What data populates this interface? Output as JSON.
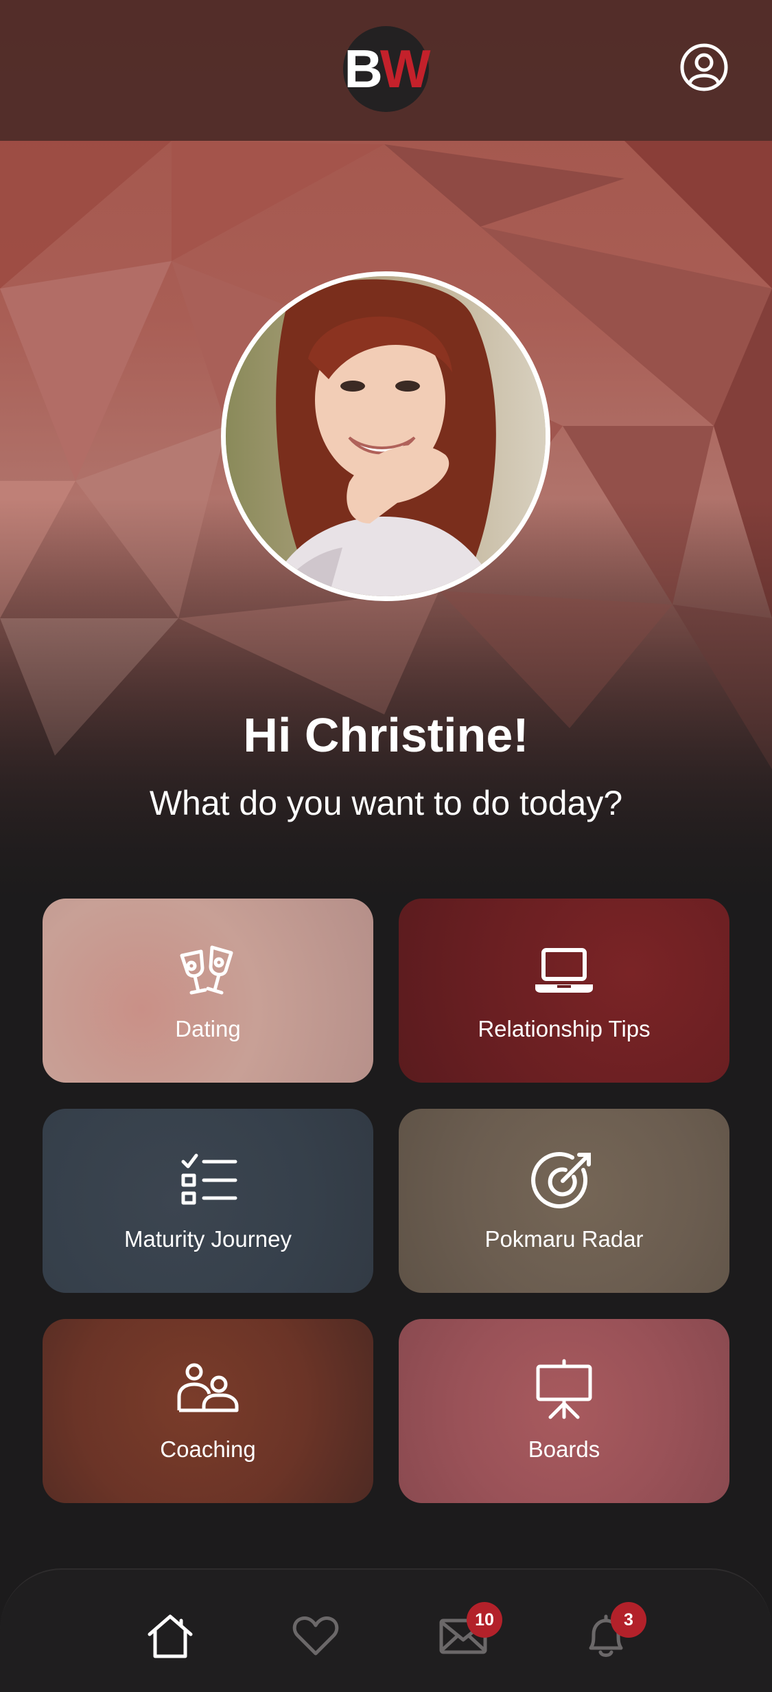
{
  "header": {
    "logo": {
      "letter1": "B",
      "letter2": "W",
      "letter2_color": "#c4212b"
    },
    "profile_icon": "user-circle-icon"
  },
  "hero": {
    "greeting": "Hi Christine!",
    "subtitle": "What do you want to do today?"
  },
  "tiles": [
    {
      "label": "Dating",
      "icon": "wine-glasses-icon",
      "color": "#c8a096"
    },
    {
      "label": "Relationship Tips",
      "icon": "laptop-icon",
      "color": "#6a1f22"
    },
    {
      "label": "Maturity Journey",
      "icon": "checklist-icon",
      "color": "#36404b"
    },
    {
      "label": "Pokmaru Radar",
      "icon": "target-icon",
      "color": "#6b5d50"
    },
    {
      "label": "Coaching",
      "icon": "people-icon",
      "color": "#6b3427"
    },
    {
      "label": "Boards",
      "icon": "presentation-board-icon",
      "color": "#9a5258"
    }
  ],
  "bottom_nav": {
    "items": [
      {
        "name": "home",
        "icon": "home-icon"
      },
      {
        "name": "favorites",
        "icon": "heart-icon"
      },
      {
        "name": "messages",
        "icon": "mail-icon",
        "badge": "10"
      },
      {
        "name": "notifications",
        "icon": "bell-icon",
        "badge": "3"
      }
    ],
    "badge_color": "#b3212a"
  },
  "colors": {
    "background": "#1c1b1c",
    "accent": "#b3212a"
  }
}
